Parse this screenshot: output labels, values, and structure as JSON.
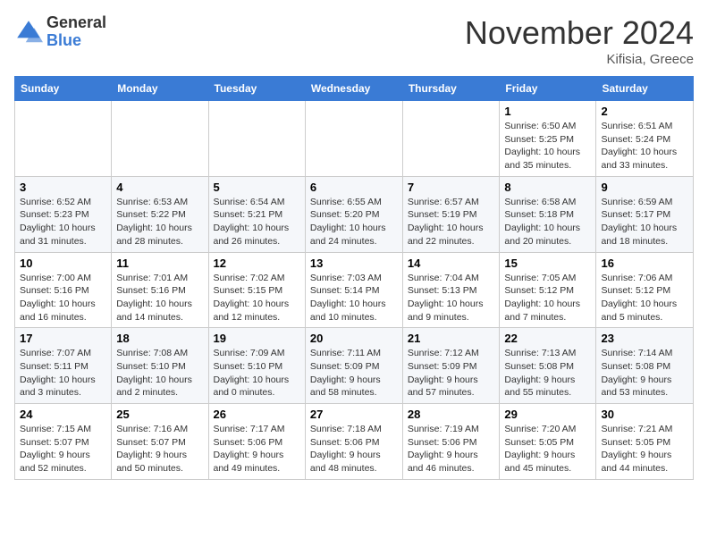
{
  "header": {
    "logo_general": "General",
    "logo_blue": "Blue",
    "month_title": "November 2024",
    "location": "Kifisia, Greece"
  },
  "weekdays": [
    "Sunday",
    "Monday",
    "Tuesday",
    "Wednesday",
    "Thursday",
    "Friday",
    "Saturday"
  ],
  "weeks": [
    [
      {
        "day": "",
        "info": ""
      },
      {
        "day": "",
        "info": ""
      },
      {
        "day": "",
        "info": ""
      },
      {
        "day": "",
        "info": ""
      },
      {
        "day": "",
        "info": ""
      },
      {
        "day": "1",
        "info": "Sunrise: 6:50 AM\nSunset: 5:25 PM\nDaylight: 10 hours and 35 minutes."
      },
      {
        "day": "2",
        "info": "Sunrise: 6:51 AM\nSunset: 5:24 PM\nDaylight: 10 hours and 33 minutes."
      }
    ],
    [
      {
        "day": "3",
        "info": "Sunrise: 6:52 AM\nSunset: 5:23 PM\nDaylight: 10 hours and 31 minutes."
      },
      {
        "day": "4",
        "info": "Sunrise: 6:53 AM\nSunset: 5:22 PM\nDaylight: 10 hours and 28 minutes."
      },
      {
        "day": "5",
        "info": "Sunrise: 6:54 AM\nSunset: 5:21 PM\nDaylight: 10 hours and 26 minutes."
      },
      {
        "day": "6",
        "info": "Sunrise: 6:55 AM\nSunset: 5:20 PM\nDaylight: 10 hours and 24 minutes."
      },
      {
        "day": "7",
        "info": "Sunrise: 6:57 AM\nSunset: 5:19 PM\nDaylight: 10 hours and 22 minutes."
      },
      {
        "day": "8",
        "info": "Sunrise: 6:58 AM\nSunset: 5:18 PM\nDaylight: 10 hours and 20 minutes."
      },
      {
        "day": "9",
        "info": "Sunrise: 6:59 AM\nSunset: 5:17 PM\nDaylight: 10 hours and 18 minutes."
      }
    ],
    [
      {
        "day": "10",
        "info": "Sunrise: 7:00 AM\nSunset: 5:16 PM\nDaylight: 10 hours and 16 minutes."
      },
      {
        "day": "11",
        "info": "Sunrise: 7:01 AM\nSunset: 5:16 PM\nDaylight: 10 hours and 14 minutes."
      },
      {
        "day": "12",
        "info": "Sunrise: 7:02 AM\nSunset: 5:15 PM\nDaylight: 10 hours and 12 minutes."
      },
      {
        "day": "13",
        "info": "Sunrise: 7:03 AM\nSunset: 5:14 PM\nDaylight: 10 hours and 10 minutes."
      },
      {
        "day": "14",
        "info": "Sunrise: 7:04 AM\nSunset: 5:13 PM\nDaylight: 10 hours and 9 minutes."
      },
      {
        "day": "15",
        "info": "Sunrise: 7:05 AM\nSunset: 5:12 PM\nDaylight: 10 hours and 7 minutes."
      },
      {
        "day": "16",
        "info": "Sunrise: 7:06 AM\nSunset: 5:12 PM\nDaylight: 10 hours and 5 minutes."
      }
    ],
    [
      {
        "day": "17",
        "info": "Sunrise: 7:07 AM\nSunset: 5:11 PM\nDaylight: 10 hours and 3 minutes."
      },
      {
        "day": "18",
        "info": "Sunrise: 7:08 AM\nSunset: 5:10 PM\nDaylight: 10 hours and 2 minutes."
      },
      {
        "day": "19",
        "info": "Sunrise: 7:09 AM\nSunset: 5:10 PM\nDaylight: 10 hours and 0 minutes."
      },
      {
        "day": "20",
        "info": "Sunrise: 7:11 AM\nSunset: 5:09 PM\nDaylight: 9 hours and 58 minutes."
      },
      {
        "day": "21",
        "info": "Sunrise: 7:12 AM\nSunset: 5:09 PM\nDaylight: 9 hours and 57 minutes."
      },
      {
        "day": "22",
        "info": "Sunrise: 7:13 AM\nSunset: 5:08 PM\nDaylight: 9 hours and 55 minutes."
      },
      {
        "day": "23",
        "info": "Sunrise: 7:14 AM\nSunset: 5:08 PM\nDaylight: 9 hours and 53 minutes."
      }
    ],
    [
      {
        "day": "24",
        "info": "Sunrise: 7:15 AM\nSunset: 5:07 PM\nDaylight: 9 hours and 52 minutes."
      },
      {
        "day": "25",
        "info": "Sunrise: 7:16 AM\nSunset: 5:07 PM\nDaylight: 9 hours and 50 minutes."
      },
      {
        "day": "26",
        "info": "Sunrise: 7:17 AM\nSunset: 5:06 PM\nDaylight: 9 hours and 49 minutes."
      },
      {
        "day": "27",
        "info": "Sunrise: 7:18 AM\nSunset: 5:06 PM\nDaylight: 9 hours and 48 minutes."
      },
      {
        "day": "28",
        "info": "Sunrise: 7:19 AM\nSunset: 5:06 PM\nDaylight: 9 hours and 46 minutes."
      },
      {
        "day": "29",
        "info": "Sunrise: 7:20 AM\nSunset: 5:05 PM\nDaylight: 9 hours and 45 minutes."
      },
      {
        "day": "30",
        "info": "Sunrise: 7:21 AM\nSunset: 5:05 PM\nDaylight: 9 hours and 44 minutes."
      }
    ]
  ]
}
